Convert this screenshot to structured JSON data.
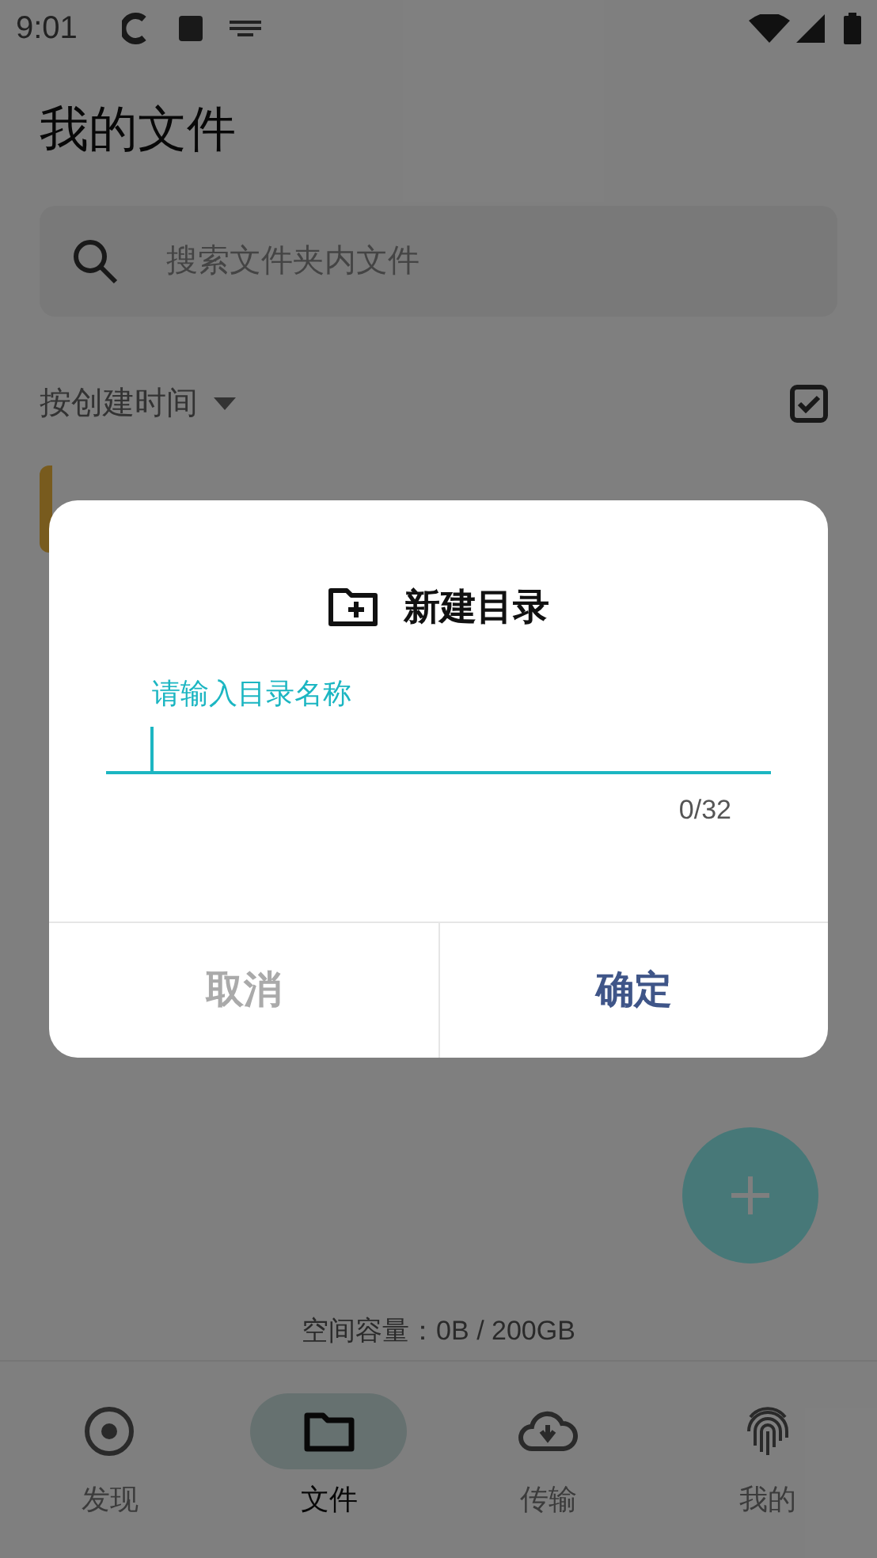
{
  "status_bar": {
    "time": "9:01"
  },
  "page": {
    "title": "我的文件",
    "search": {
      "placeholder": "搜索文件夹内文件"
    },
    "sort": {
      "label": "按创建时间"
    },
    "select_all": {
      "checked": true
    },
    "storage": "空间容量：0B / 200GB"
  },
  "dialog": {
    "title": "新建目录",
    "field": {
      "label": "请输入目录名称",
      "counter": "0/32"
    },
    "buttons": [
      {
        "label": "取消",
        "kind": "cancel"
      },
      {
        "label": "确定",
        "kind": "confirm"
      }
    ]
  },
  "bottom_nav": [
    {
      "label": "发现",
      "kind": "target",
      "selected": false
    },
    {
      "label": "文件",
      "kind": "folder",
      "selected": true
    },
    {
      "label": "传输",
      "kind": "cloud",
      "selected": false
    },
    {
      "label": "我的",
      "kind": "fingerprint",
      "selected": false
    }
  ]
}
